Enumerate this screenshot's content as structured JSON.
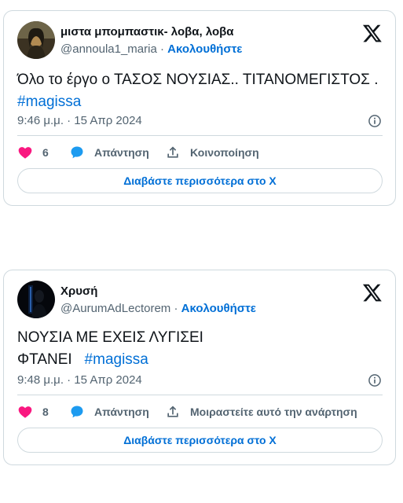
{
  "tweets": [
    {
      "display_name": "μιστα μπομπαστικ- λοβα, λοβα",
      "handle": "@annoula1_maria",
      "separator": " · ",
      "follow_label": "Ακολουθήστε",
      "text_line1": "Όλο το έργο ο ΤΑΣΟΣ ΝΟΥΣΙΑΣ.. ΤΙΤΑΝΟΜΕΓΙΣΤΟΣ .",
      "hashtag": "#magissa",
      "timestamp": "9:46 μ.μ. · 15 Απρ 2024",
      "like_count": "6",
      "reply_label": "Απάντηση",
      "share_label": "Κοινοποίηση",
      "read_more_label": "Διαβάστε περισσότερα στο X"
    },
    {
      "display_name": "Χρυσή",
      "handle": "@AurumAdLectorem",
      "separator": " · ",
      "follow_label": "Ακολουθήστε",
      "text_line1": "ΝΟΥΣΙΑ ΜΕ ΕΧΕΙΣ ΛΥΓΙΣΕΙ",
      "text_line2": "ΦΤΑΝΕΙ",
      "hashtag": "#magissa",
      "timestamp": "9:48 μ.μ. · 15 Απρ 2024",
      "like_count": "8",
      "reply_label": "Απάντηση",
      "share_label": "Μοιραστείτε αυτό την ανάρτηση",
      "read_more_label": "Διαβάστε περισσότερα στο X"
    }
  ],
  "colors": {
    "link": "#006fd6",
    "like": "#f91880",
    "reply": "#1d9bf0",
    "muted": "#536471",
    "border": "#cfd9de"
  },
  "icons": {
    "logo": "x-logo-icon",
    "info": "info-icon",
    "like": "heart-icon",
    "reply": "reply-bubble-icon",
    "share": "share-upload-icon"
  }
}
